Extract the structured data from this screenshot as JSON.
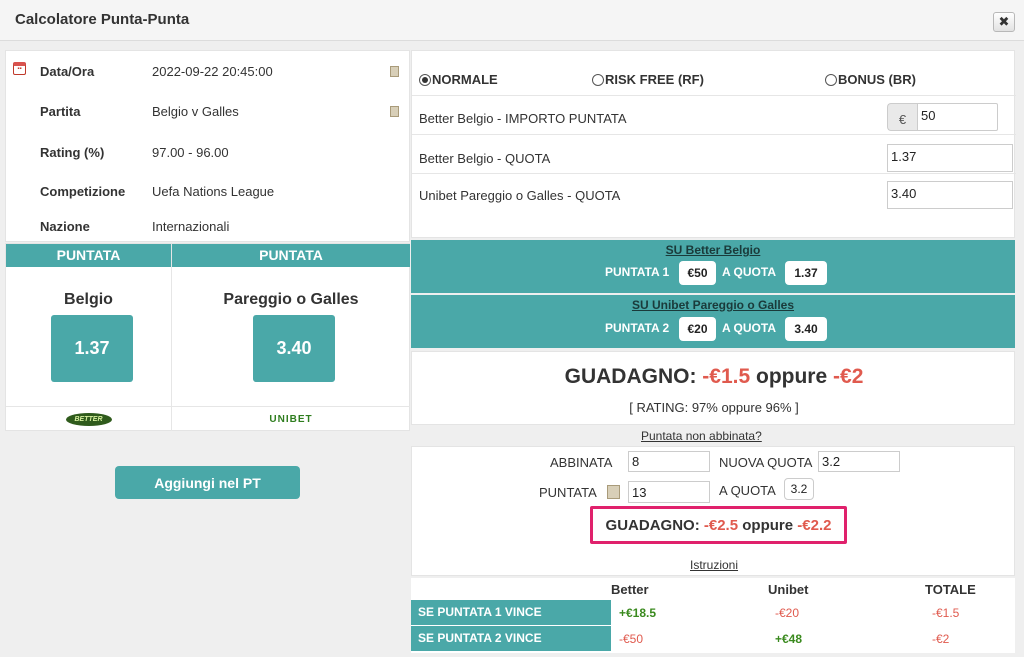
{
  "window": {
    "title": "Calcolatore Punta-Punta",
    "close_label": "✖"
  },
  "info": {
    "rows": [
      {
        "label": "Data/Ora",
        "value": "2022-09-22 20:45:00"
      },
      {
        "label": "Partita",
        "value": "Belgio v Galles"
      },
      {
        "label": "Rating (%)",
        "value": "97.00 - 96.00"
      },
      {
        "label": "Competizione",
        "value": "Uefa Nations League"
      },
      {
        "label": "Nazione",
        "value": "Internazionali"
      }
    ]
  },
  "bets": [
    {
      "header": "PUNTATA",
      "name": "Belgio",
      "odds": "1.37",
      "bookmaker_logo": "BETTER"
    },
    {
      "header": "PUNTATA",
      "name": "Pareggio o Galles",
      "odds": "3.40",
      "bookmaker_logo": "UNIBET"
    }
  ],
  "add_button": "Aggiungi nel PT",
  "modes": [
    {
      "label": "NORMALE",
      "selected": true
    },
    {
      "label": "RISK FREE (RF)",
      "selected": false
    },
    {
      "label": "BONUS (BR)",
      "selected": false
    }
  ],
  "form": {
    "stake_label": "Better Belgio - IMPORTO PUNTATA",
    "currency": "€",
    "stake_value": "50",
    "quota1_label": "Better Belgio - QUOTA",
    "quota1_value": "1.37",
    "quota2_label": "Unibet Pareggio o Galles  - QUOTA",
    "quota2_value": "3.40"
  },
  "bands": [
    {
      "title": "SU Better Belgio",
      "puntata_label": "PUNTATA 1",
      "amount": "€50",
      "quota_label": "A QUOTA",
      "quota": "1.37"
    },
    {
      "title": "SU Unibet Pareggio o Galles",
      "puntata_label": "PUNTATA 2",
      "amount": "€20",
      "quota_label": "A QUOTA",
      "quota": "3.40"
    }
  ],
  "result": {
    "gain_label": "GUADAGNO:",
    "gain1": "-€1.5",
    "or_text": "oppure",
    "gain2": "-€2",
    "rating_text": "[ RATING: 97% oppure 96% ]"
  },
  "unmatched": {
    "link": "Puntata non abbinata?",
    "abbinata_label": "ABBINATA",
    "abbinata_value": "8",
    "nuova_quota_label": "NUOVA QUOTA",
    "nuova_quota_value": "3.2",
    "puntata_label": "PUNTATA",
    "puntata_value": "13",
    "a_quota_label": "A QUOTA",
    "a_quota_value": "3.2",
    "gain_label": "GUADAGNO:",
    "gain1": "-€2.5",
    "or_text": "oppure",
    "gain2": "-€2.2",
    "instructions_link": "Istruzioni"
  },
  "summary": {
    "headers": [
      "Better",
      "Unibet",
      "TOTALE"
    ],
    "rows": [
      {
        "label": "SE PUNTATA 1 VINCE",
        "better": "+€18.5",
        "unibet": "-€20",
        "totale": "-€1.5"
      },
      {
        "label": "SE PUNTATA 2 VINCE",
        "better": "-€50",
        "unibet": "+€48",
        "totale": "-€2"
      }
    ]
  },
  "colors": {
    "teal": "#4aa8a8",
    "negative": "#e05a4e",
    "positive": "#3a8a1e",
    "highlight": "#e0216c"
  }
}
